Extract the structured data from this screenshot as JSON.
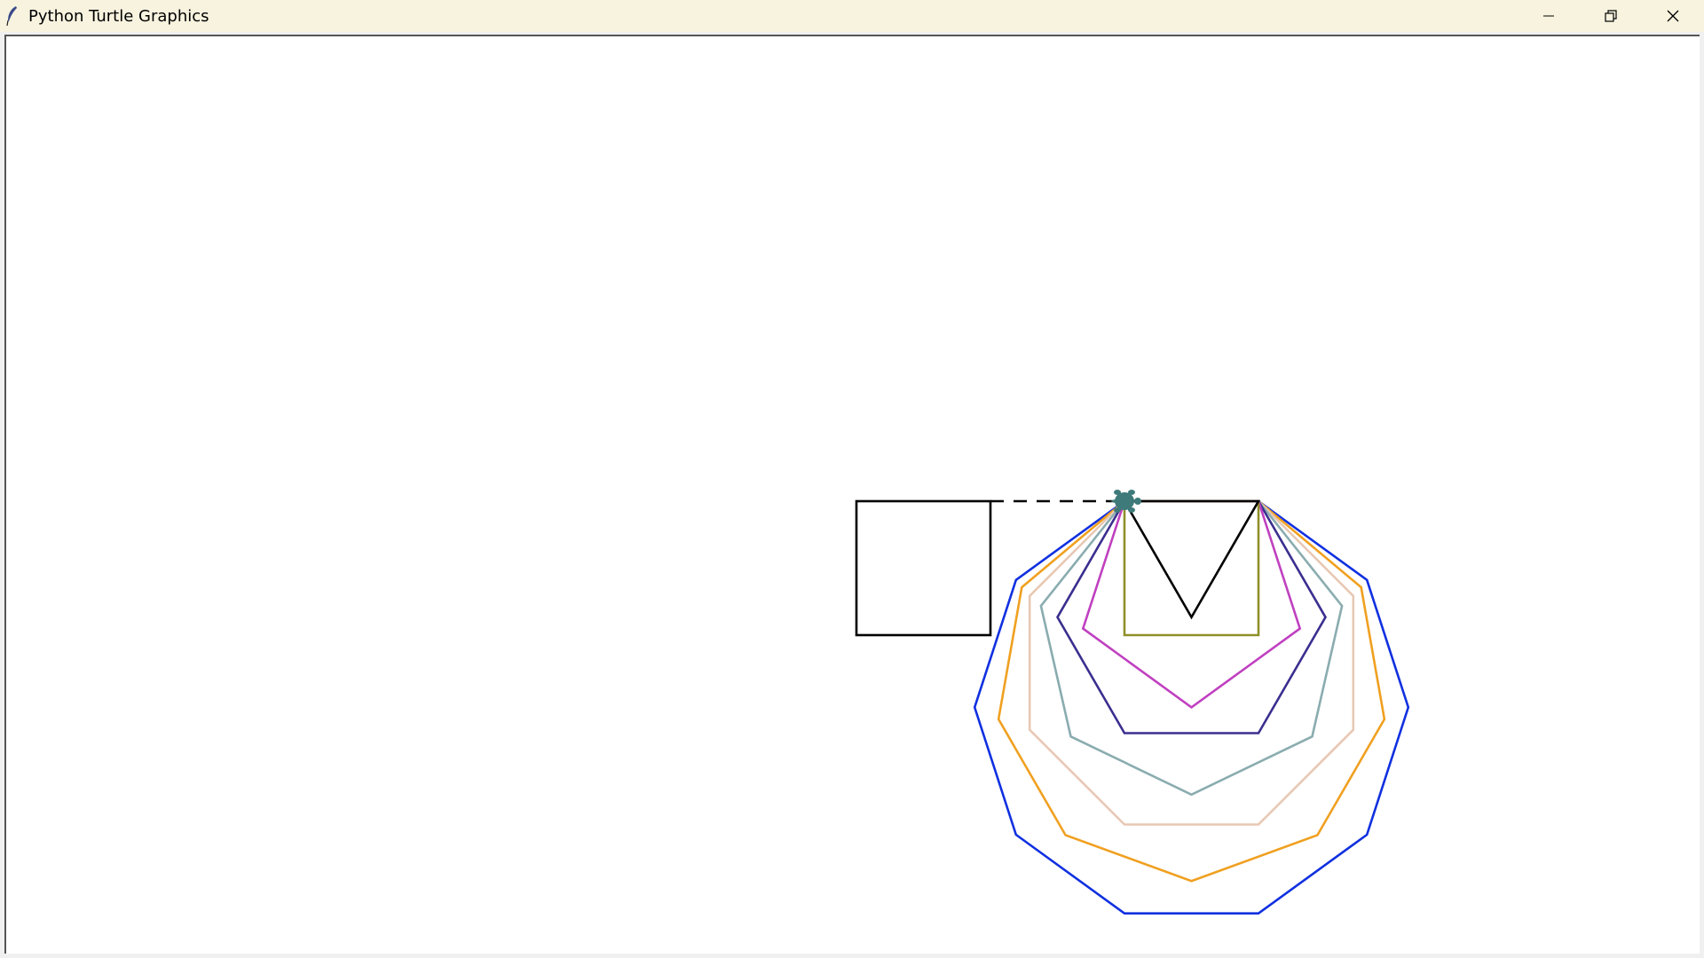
{
  "window": {
    "title": "Python Turtle Graphics",
    "icon": "feather-icon",
    "controls": [
      {
        "name": "minimize-button",
        "icon": "minimize-icon"
      },
      {
        "name": "restore-button",
        "icon": "restore-icon"
      },
      {
        "name": "close-button",
        "icon": "close-icon"
      }
    ]
  },
  "canvas": {
    "background": "#ffffff",
    "turtle": {
      "shape": "turtle",
      "color": "#3f7a7a"
    },
    "drawing": {
      "square": {
        "color": "#000000",
        "sides": 4
      },
      "dashed_line": {
        "color": "#000000"
      },
      "polygons": [
        {
          "name": "triangle",
          "sides": 3,
          "color": "#000000"
        },
        {
          "name": "square",
          "sides": 4,
          "color": "#8f8f2a"
        },
        {
          "name": "pentagon",
          "sides": 5,
          "color": "#c040c0"
        },
        {
          "name": "hexagon",
          "sides": 6,
          "color": "#3a2f8f"
        },
        {
          "name": "heptagon",
          "sides": 7,
          "color": "#8aacaf"
        },
        {
          "name": "octagon",
          "sides": 8,
          "color": "#e8c8b4"
        },
        {
          "name": "nonagon",
          "sides": 9,
          "color": "#f0a020"
        },
        {
          "name": "decagon",
          "sides": 10,
          "color": "#1030e0"
        }
      ]
    }
  }
}
